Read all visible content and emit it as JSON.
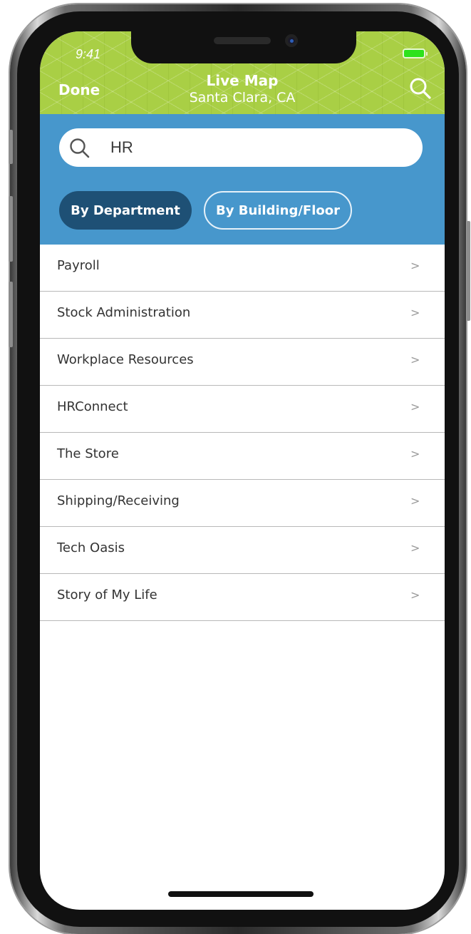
{
  "status_bar": {
    "time": "9:41"
  },
  "header": {
    "done_label": "Done",
    "title": "Live Map",
    "subtitle": "Santa Clara, CA",
    "search_icon": "search-icon"
  },
  "search": {
    "value": "HR",
    "icon": "search-icon"
  },
  "tabs": [
    {
      "label": "By Department",
      "active": true
    },
    {
      "label": "By Building/Floor",
      "active": false
    }
  ],
  "results": [
    {
      "label": "Payroll",
      "chevron": ">"
    },
    {
      "label": "Stock Administration",
      "chevron": ">"
    },
    {
      "label": "Workplace Resources",
      "chevron": ">"
    },
    {
      "label": "HRConnect",
      "chevron": ">"
    },
    {
      "label": "The Store",
      "chevron": ">"
    },
    {
      "label": "Shipping/Receiving",
      "chevron": ">"
    },
    {
      "label": "Tech Oasis",
      "chevron": ">"
    },
    {
      "label": "Story of My Life",
      "chevron": ">"
    }
  ],
  "colors": {
    "header_green": "#a9cf45",
    "panel_blue": "#4797cc",
    "active_tab": "#1e5075",
    "battery_green": "#2ee21c"
  }
}
